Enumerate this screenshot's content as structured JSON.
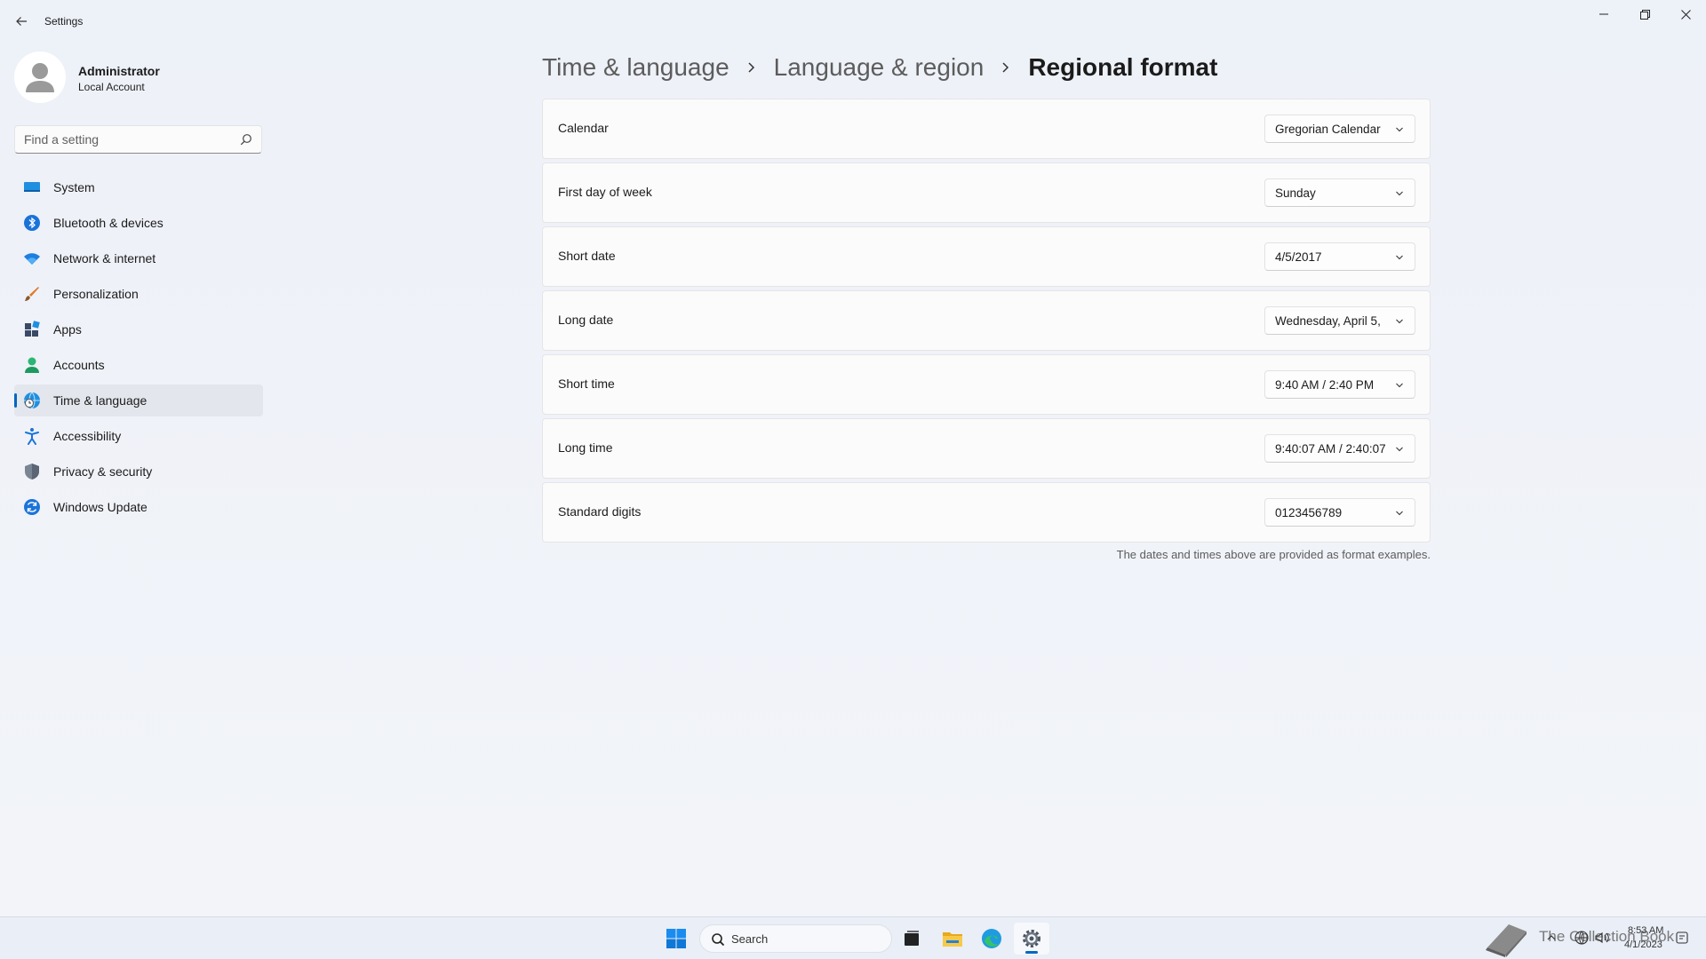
{
  "window": {
    "title": "Settings",
    "controls": {
      "minimize": "minimize",
      "restore": "restore",
      "close": "close"
    }
  },
  "profile": {
    "name": "Administrator",
    "account_type": "Local Account"
  },
  "search": {
    "placeholder": "Find a setting"
  },
  "nav": {
    "items": [
      {
        "label": "System",
        "icon": "monitor-icon"
      },
      {
        "label": "Bluetooth & devices",
        "icon": "bluetooth-icon"
      },
      {
        "label": "Network & internet",
        "icon": "wifi-icon"
      },
      {
        "label": "Personalization",
        "icon": "brush-icon"
      },
      {
        "label": "Apps",
        "icon": "apps-icon"
      },
      {
        "label": "Accounts",
        "icon": "person-icon"
      },
      {
        "label": "Time & language",
        "icon": "globe-clock-icon",
        "active": true
      },
      {
        "label": "Accessibility",
        "icon": "accessibility-icon"
      },
      {
        "label": "Privacy & security",
        "icon": "shield-icon"
      },
      {
        "label": "Windows Update",
        "icon": "update-icon"
      }
    ]
  },
  "breadcrumb": {
    "items": [
      "Time & language",
      "Language & region",
      "Regional format"
    ]
  },
  "settings": [
    {
      "label": "Calendar",
      "value": "Gregorian Calendar"
    },
    {
      "label": "First day of week",
      "value": "Sunday"
    },
    {
      "label": "Short date",
      "value": "4/5/2017"
    },
    {
      "label": "Long date",
      "value": "Wednesday, April 5,"
    },
    {
      "label": "Short time",
      "value": "9:40 AM / 2:40 PM"
    },
    {
      "label": "Long time",
      "value": "9:40:07 AM / 2:40:07"
    },
    {
      "label": "Standard digits",
      "value": "0123456789"
    }
  ],
  "footnote": "The dates and times above are provided as format examples.",
  "taskbar": {
    "search_label": "Search",
    "time": "8:53 AM",
    "date": "4/1/2023",
    "watermark": "The Collection Book"
  },
  "colors": {
    "accent": "#0067c0",
    "background": "#eef2f9",
    "card": "#fbfbfc"
  }
}
